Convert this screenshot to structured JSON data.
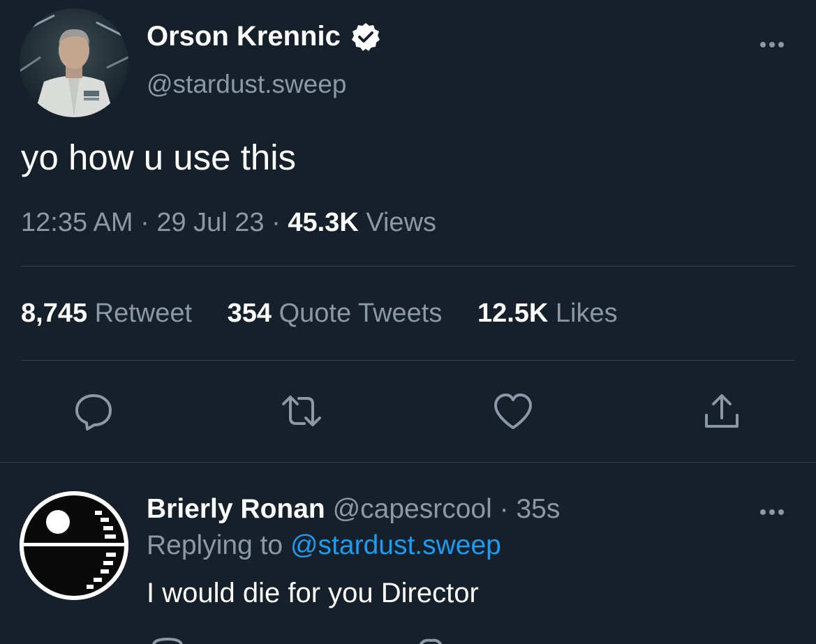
{
  "tweet": {
    "author": {
      "display_name": "Orson Krennic",
      "handle": "@stardust.sweep",
      "verified": true,
      "avatar_icon": "officer-portrait-avatar"
    },
    "text": "yo how u use this",
    "time": "12:35 AM",
    "date": "29 Jul 23",
    "views_count": "45.3K",
    "views_label": "Views",
    "separator": "·",
    "stats": {
      "retweets_count": "8,745",
      "retweets_label": "Retweet",
      "quotes_count": "354",
      "quotes_label": "Quote Tweets",
      "likes_count": "12.5K",
      "likes_label": "Likes"
    },
    "actions": [
      "reply-icon",
      "retweet-icon",
      "like-icon",
      "share-icon"
    ],
    "more_icon": "more-icon"
  },
  "reply": {
    "author": {
      "display_name": "Brierly Ronan",
      "handle": "@capesrcool",
      "avatar_icon": "death-star-avatar"
    },
    "separator": "·",
    "time_ago": "35s",
    "replying_prefix": "Replying to",
    "replying_to": "@stardust.sweep",
    "text": "I would die for you Director"
  },
  "colors": {
    "background": "#15202b",
    "primary_text": "#ffffff",
    "secondary_text": "#8b98a5",
    "divider": "#38444d",
    "link": "#1d9bf0"
  }
}
